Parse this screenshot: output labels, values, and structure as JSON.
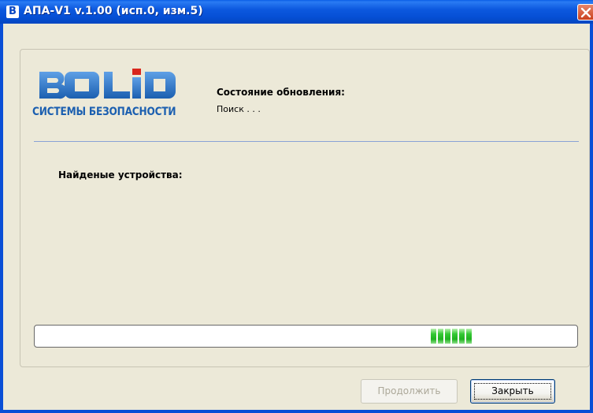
{
  "window": {
    "title": "АПА-V1 v.1.00 (исп.0, изм.5)",
    "icon_letter": "B",
    "titlebar_color": "#0a4fd6"
  },
  "logo": {
    "brand": "BOLID",
    "subtitle": "СИСТЕМЫ БЕЗОПАСНОСТИ",
    "brand_color": "#1b5fb0"
  },
  "status": {
    "label": "Состояние обновления:",
    "value": "Поиск . . ."
  },
  "devices": {
    "label": "Найденые устройства:"
  },
  "progress": {
    "style": "marquee",
    "color": "#1fb21f"
  },
  "buttons": {
    "continue_label": "Продолжить",
    "close_label": "Закрыть"
  }
}
